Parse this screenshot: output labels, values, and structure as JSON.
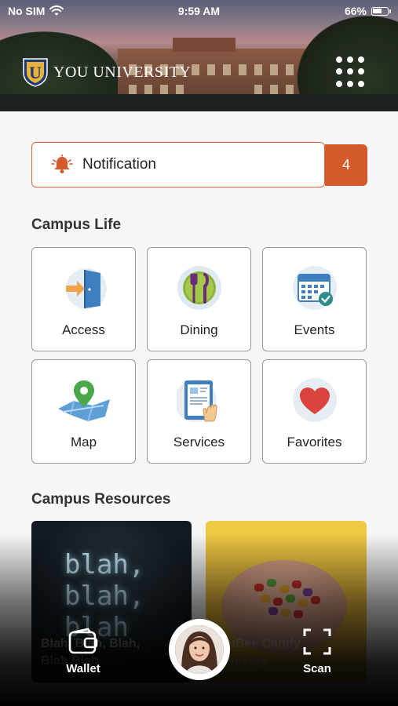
{
  "status_bar": {
    "carrier": "No SIM",
    "time": "9:59 AM",
    "battery": "66%",
    "battery_level": 0.66
  },
  "header": {
    "logo_letter": "U",
    "logo_text": "YOU UNIVERSITY",
    "menu_icon": "grid-icon"
  },
  "notification": {
    "label": "Notification",
    "count": "4",
    "icon": "bell-icon"
  },
  "campus_life": {
    "title": "Campus Life",
    "tiles": [
      {
        "label": "Access",
        "icon": "door-icon"
      },
      {
        "label": "Dining",
        "icon": "fork-knife-icon"
      },
      {
        "label": "Events",
        "icon": "calendar-icon"
      },
      {
        "label": "Map",
        "icon": "map-pin-icon"
      },
      {
        "label": "Services",
        "icon": "tablet-icon"
      },
      {
        "label": "Favorites",
        "icon": "heart-icon"
      }
    ]
  },
  "campus_resources": {
    "title": "Campus Resources",
    "cards": [
      {
        "image_text": [
          "blah,",
          "blah,",
          "blah"
        ],
        "caption": "Blah, Blah, Blah,",
        "caption2": "Blah Blah"
      },
      {
        "caption": "uBee Candy",
        "caption2": "elivery"
      }
    ]
  },
  "tabbar": {
    "wallet": "Wallet",
    "scan": "Scan"
  },
  "colors": {
    "accent": "#d45a2b",
    "tile_border": "#9a9a9a"
  }
}
